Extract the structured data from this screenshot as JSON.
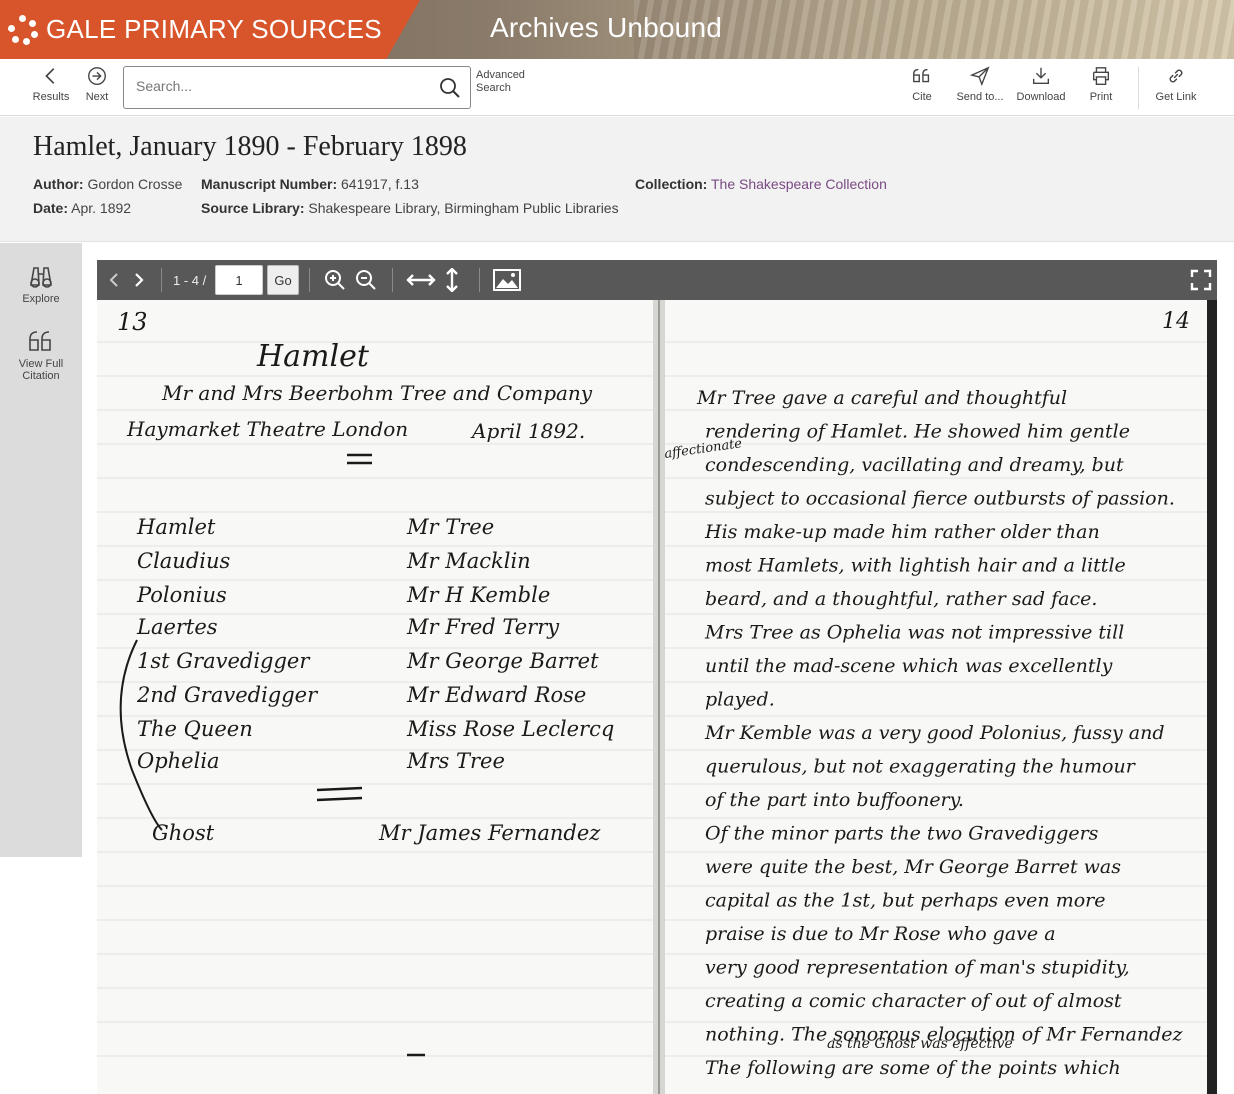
{
  "banner": {
    "brand": "GALE PRIMARY SOURCES",
    "product": "Archives Unbound",
    "brand_color": "#d8542b"
  },
  "toolbar": {
    "results_label": "Results",
    "next_label": "Next",
    "search_placeholder": "Search...",
    "advanced_search_label": "Advanced Search",
    "cite_label": "Cite",
    "send_label": "Send to...",
    "download_label": "Download",
    "print_label": "Print",
    "get_link_label": "Get Link"
  },
  "document": {
    "title": "Hamlet, January 1890 - February 1898",
    "author_label": "Author:",
    "author": "Gordon Crosse",
    "date_label": "Date:",
    "date": "Apr. 1892",
    "manuscript_label": "Manuscript Number:",
    "manuscript": "641917, f.13",
    "source_label": "Source Library:",
    "source": "Shakespeare Library, Birmingham Public Libraries",
    "collection_label": "Collection:",
    "collection": "The Shakespeare Collection",
    "link_color": "#7b4a84"
  },
  "sidebar": {
    "explore_label": "Explore",
    "citation_label": "View Full Citation"
  },
  "viewer": {
    "page_count": "1 - 4 /",
    "page_value": "1",
    "go_label": "Go"
  },
  "manuscript": {
    "left_page_no": "13",
    "right_page_no": "14",
    "heading": "Hamlet",
    "company": "Mr and Mrs Beerbohm Tree and Company",
    "theatre": "Haymarket Theatre London",
    "date_line": "April 1892.",
    "cast": [
      {
        "role": "Hamlet",
        "actor": "Mr Tree"
      },
      {
        "role": "Claudius",
        "actor": "Mr Macklin"
      },
      {
        "role": "Polonius",
        "actor": "Mr H Kemble"
      },
      {
        "role": "Laertes",
        "actor": "Mr Fred Terry"
      },
      {
        "role": "1st Gravedigger",
        "actor": "Mr George Barret"
      },
      {
        "role": "2nd Gravedigger",
        "actor": "Mr Edward Rose"
      },
      {
        "role": "The Queen",
        "actor": "Miss Rose Leclercq"
      },
      {
        "role": "Ophelia",
        "actor": "Mrs Tree"
      },
      {
        "role": "Ghost",
        "actor": "Mr James Fernandez"
      }
    ],
    "right_lines": [
      "Mr Tree gave a careful and thoughtful",
      "rendering of Hamlet. He showed him gentle",
      "condescending, vacillating and dreamy, but",
      "subject to occasional fierce outbursts of passion.",
      "His make-up made him rather older than",
      "most Hamlets, with lightish hair and a little",
      "beard, and a thoughtful, rather sad face.",
      "Mrs Tree as Ophelia was not impressive till",
      "until the mad-scene which was excellently",
      "played.",
      "Mr Kemble was a very good Polonius, fussy and",
      "querulous, but not exaggerating the humour",
      "of the part into buffoonery.",
      "Of the minor parts the two Gravediggers",
      "were quite the best, Mr George Barret was",
      "capital as the 1st, but perhaps even more",
      "praise is due to Mr Rose who gave a",
      "very good representation of man's stupidity,",
      "creating a comic character of out of almost",
      "nothing. The sonorous elocution of Mr Fernandez",
      "The following are some of the points which"
    ],
    "margin_note": "affectionate",
    "ghost_note": "as the Ghost was effective"
  }
}
